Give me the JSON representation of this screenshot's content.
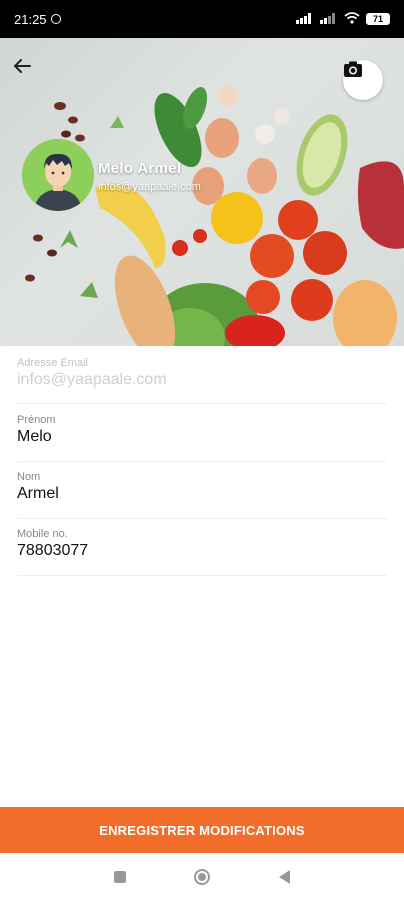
{
  "status_bar": {
    "time": "21:25",
    "battery": "71"
  },
  "header": {
    "profile_name": "Melo Armel",
    "profile_email": "infos@yaapaale.com"
  },
  "form": {
    "fields": [
      {
        "label": "Adresse Email",
        "value": "infos@yaapaale.com",
        "disabled": true
      },
      {
        "label": "Prénom",
        "value": "Melo"
      },
      {
        "label": "Nom",
        "value": "Armel"
      },
      {
        "label": "Mobile no.",
        "value": "78803077"
      }
    ]
  },
  "actions": {
    "save_label": "ENREGISTRER MODIFICATIONS"
  },
  "colors": {
    "accent": "#f26c2a",
    "avatar_bg": "#8ccf5a"
  }
}
